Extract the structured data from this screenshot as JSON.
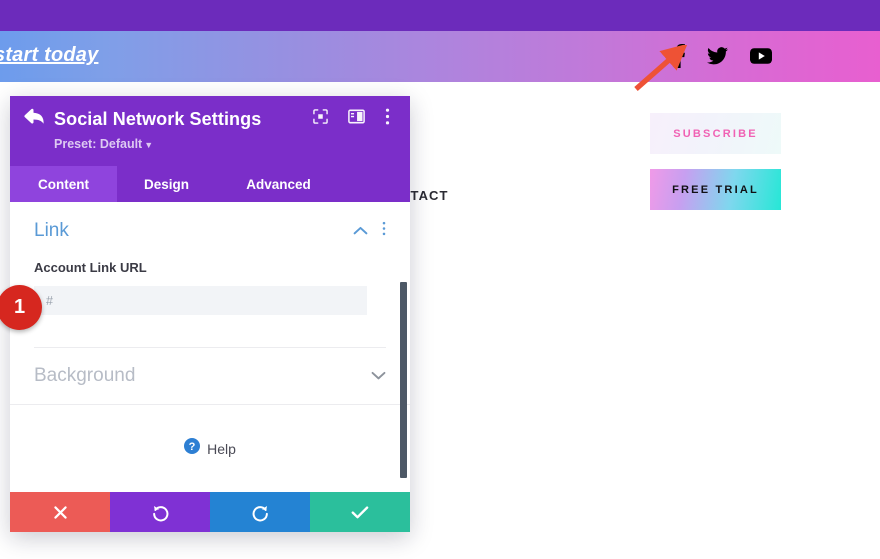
{
  "page": {
    "promo_link_text": "start today",
    "contact_nav_text": "NTACT",
    "social_icons": [
      {
        "name": "facebook-icon",
        "label": "Facebook"
      },
      {
        "name": "twitter-icon",
        "label": "Twitter"
      },
      {
        "name": "youtube-icon",
        "label": "YouTube"
      }
    ],
    "buttons": {
      "subscribe_label": "SUBSCRIBE",
      "free_trial_label": "FREE TRIAL"
    },
    "colors": {
      "topbar": "#6c2bbb",
      "band_start": "#6d9cec",
      "band_end": "#e85fd0",
      "subscribe_text": "#f062b4",
      "free_trial_text": "#101014",
      "annotation_arrow": "#ee5235"
    }
  },
  "modal": {
    "title": "Social Network Settings",
    "preset_label": "Preset: Default",
    "header_icons": [
      {
        "name": "fullscreen-icon"
      },
      {
        "name": "split-view-icon"
      },
      {
        "name": "more-options-icon"
      }
    ],
    "tabs": [
      {
        "label": "Content",
        "active": true
      },
      {
        "label": "Design",
        "active": false
      },
      {
        "label": "Advanced",
        "active": false
      }
    ],
    "sections": {
      "link": {
        "title": "Link",
        "collapse_state": "expanded",
        "field_label": "Account Link URL",
        "field_value": "",
        "field_placeholder": "#"
      },
      "background": {
        "title": "Background",
        "collapse_state": "collapsed"
      }
    },
    "help_label": "Help",
    "footer_buttons": [
      {
        "name": "cancel-button",
        "icon": "close-icon",
        "color": "#ec5b56"
      },
      {
        "name": "undo-button",
        "icon": "undo-icon",
        "color": "#7f31d4"
      },
      {
        "name": "redo-button",
        "icon": "redo-icon",
        "color": "#2483d3"
      },
      {
        "name": "save-button",
        "icon": "check-icon",
        "color": "#2bbf9c"
      }
    ],
    "colors": {
      "header": "#7b2ec9",
      "tab_active": "#8f44dd",
      "link_title": "#5a9ad6",
      "background_title": "#b7bcc6"
    }
  },
  "annotation": {
    "step_number": "1",
    "badge_color": "#d6271f"
  }
}
